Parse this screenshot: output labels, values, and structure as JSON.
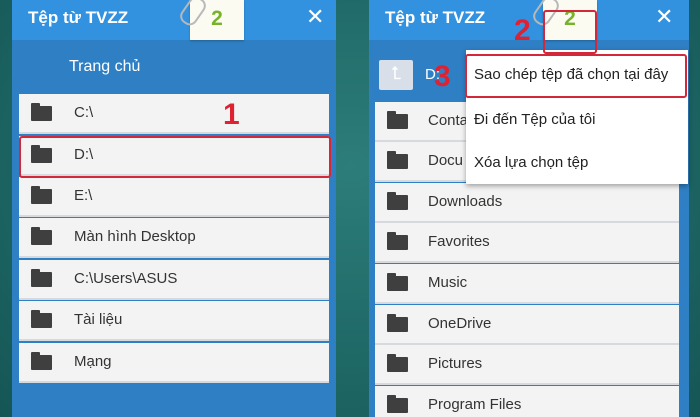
{
  "colors": {
    "accent": "#3392e0",
    "highlight": "#d2283a",
    "badge_green": "#77b32a"
  },
  "left_window": {
    "title": "Tệp từ TVZZ",
    "close_icon": "close-icon",
    "clipboard_count": "2",
    "home_label": "Trang chủ",
    "items": [
      {
        "label": "C:\\",
        "icon": "folder-icon"
      },
      {
        "label": "D:\\",
        "icon": "folder-icon"
      },
      {
        "label": "E:\\",
        "icon": "folder-icon"
      },
      {
        "label": "Màn hình Desktop",
        "icon": "folder-icon"
      },
      {
        "label": "C:\\Users\\ASUS",
        "icon": "folder-icon"
      },
      {
        "label": "Tài liệu",
        "icon": "folder-icon"
      },
      {
        "label": "Mạng",
        "icon": "folder-icon"
      }
    ]
  },
  "right_window": {
    "title": "Tệp từ TVZZ",
    "close_icon": "close-icon",
    "clipboard_count": "2",
    "up_icon": "arrow-up-icon",
    "path_label": "D:",
    "items": [
      {
        "label": "Conta",
        "icon": "folder-icon"
      },
      {
        "label": "Docu",
        "icon": "folder-icon"
      },
      {
        "label": "Downloads",
        "icon": "folder-icon"
      },
      {
        "label": "Favorites",
        "icon": "folder-icon"
      },
      {
        "label": "Music",
        "icon": "folder-icon"
      },
      {
        "label": "OneDrive",
        "icon": "folder-icon"
      },
      {
        "label": "Pictures",
        "icon": "folder-icon"
      },
      {
        "label": "Program Files",
        "icon": "folder-icon"
      }
    ]
  },
  "context_menu": {
    "items": [
      {
        "label": "Sao chép tệp đã chọn tại đây"
      },
      {
        "label": "Đi đến Tệp của tôi"
      },
      {
        "label": "Xóa lựa chọn tệp"
      }
    ]
  },
  "annotations": {
    "step1": "1",
    "step2": "2",
    "step3": "3"
  }
}
